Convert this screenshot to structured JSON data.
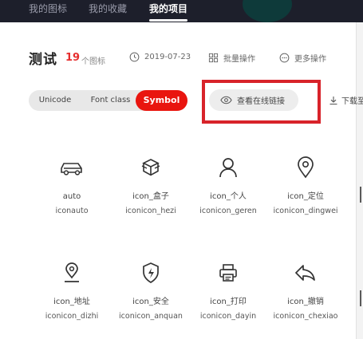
{
  "topnav": {
    "tabs": [
      {
        "label": "我的图标"
      },
      {
        "label": "我的收藏"
      },
      {
        "label": "我的项目"
      }
    ]
  },
  "project": {
    "title": "测试",
    "count": "19",
    "count_unit": "个图标",
    "date": "2019-07-23",
    "batch_label": "批量操作",
    "more_label": "更多操作"
  },
  "segmented": {
    "options": [
      "Unicode",
      "Font class",
      "Symbol"
    ],
    "selected": "Symbol"
  },
  "actions": {
    "view_link_label": "查看在线链接",
    "download_label": "下载至"
  },
  "icons": [
    {
      "name": "auto",
      "code": "iconauto",
      "icon": "car-icon"
    },
    {
      "name": "icon_盒子",
      "code": "iconicon_hezi",
      "icon": "box-icon"
    },
    {
      "name": "icon_个人",
      "code": "iconicon_geren",
      "icon": "person-icon"
    },
    {
      "name": "icon_定位",
      "code": "iconicon_dingwei",
      "icon": "location-pin-icon"
    },
    {
      "name": "icon_地址",
      "code": "iconicon_dizhi",
      "icon": "address-icon"
    },
    {
      "name": "icon_安全",
      "code": "iconicon_anquan",
      "icon": "shield-icon"
    },
    {
      "name": "icon_打印",
      "code": "iconicon_dayin",
      "icon": "printer-icon"
    },
    {
      "name": "icon_撤销",
      "code": "iconicon_chexiao",
      "icon": "undo-icon"
    }
  ],
  "colors": {
    "accent": "#e9150f",
    "highlight": "#d8232a",
    "nav_bg": "#1d1f2b"
  }
}
